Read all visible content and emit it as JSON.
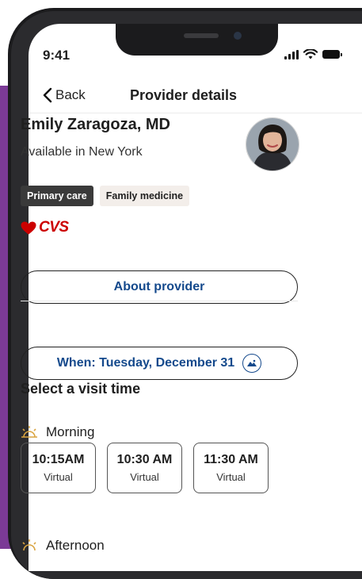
{
  "status_bar": {
    "time": "9:41"
  },
  "nav": {
    "back_label": "Back",
    "title": "Provider details"
  },
  "provider": {
    "name": "Emily Zaragoza, MD",
    "location": "Available in New York",
    "tags": [
      "Primary care",
      "Family medicine"
    ],
    "brand": "CVS"
  },
  "actions": {
    "about_label": "About provider",
    "when_label": "When: Tuesday, December 31"
  },
  "visit": {
    "section_title": "Select a visit time",
    "morning_label": "Morning",
    "afternoon_label": "Afternoon",
    "slots": [
      {
        "time": "10:15AM",
        "type": "Virtual"
      },
      {
        "time": "10:30 AM",
        "type": "Virtual"
      },
      {
        "time": "11:30 AM",
        "type": "Virtual"
      }
    ]
  },
  "colors": {
    "link_blue": "#14498c",
    "brand_red": "#cc0000",
    "accent_purple": "#7b3a96"
  },
  "icons": [
    "chevron-left-icon",
    "signal-icon",
    "wifi-icon",
    "battery-icon",
    "heart-icon",
    "calendar-icon",
    "sun-icon"
  ]
}
